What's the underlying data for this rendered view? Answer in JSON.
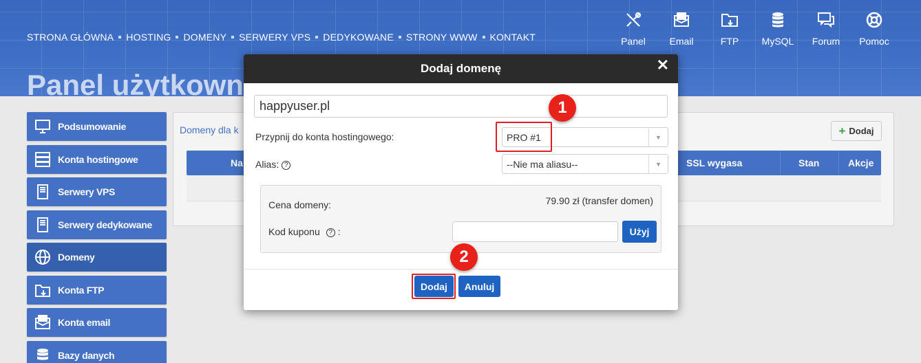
{
  "topnav": {
    "items": [
      "STRONA GŁÓWNA",
      "HOSTING",
      "DOMENY",
      "SERWERY VPS",
      "DEDYKOWANE",
      "STRONY WWW",
      "KONTAKT"
    ]
  },
  "tools": [
    {
      "label": "Panel",
      "icon": "tools-icon"
    },
    {
      "label": "Email",
      "icon": "email-icon"
    },
    {
      "label": "FTP",
      "icon": "ftp-folder-icon"
    },
    {
      "label": "MySQL",
      "icon": "database-icon"
    },
    {
      "label": "Forum",
      "icon": "forum-icon"
    },
    {
      "label": "Pomoc",
      "icon": "lifebuoy-icon"
    }
  ],
  "page_title": "Panel użytkown",
  "sidebar": {
    "items": [
      {
        "label": "Podsumowanie",
        "icon": "monitor-icon"
      },
      {
        "label": "Konta hostingowe",
        "icon": "server-rack-icon"
      },
      {
        "label": "Serwery VPS",
        "icon": "server-tower-icon"
      },
      {
        "label": "Serwery dedykowane",
        "icon": "server-tower-icon"
      },
      {
        "label": "Domeny",
        "icon": "www-globe-icon"
      },
      {
        "label": "Konta FTP",
        "icon": "ftp-folder-icon"
      },
      {
        "label": "Konta email",
        "icon": "email-icon"
      },
      {
        "label": "Bazy danych",
        "icon": "database-icon"
      }
    ]
  },
  "panel": {
    "title": "Domeny dla k",
    "add_button": "Dodaj",
    "columns": {
      "name": "Na",
      "ssl": "SSL wygasa",
      "status": "Stan",
      "actions": "Akcje"
    }
  },
  "modal": {
    "title": "Dodaj domenę",
    "domain_value": "happyuser.pl",
    "hosting_label": "Przypnij do konta hostingowego:",
    "hosting_selected": "PRO #1",
    "alias_label": "Alias:",
    "alias_selected": "--Nie ma aliasu--",
    "price_label": "Cena domeny:",
    "price_value": "79.90 zł (transfer domen)",
    "coupon_label": "Kod kuponu",
    "coupon_suffix": ":",
    "use_button": "Użyj",
    "add_button": "Dodaj",
    "cancel_button": "Anuluj"
  },
  "annotations": {
    "step1": "1",
    "step2": "2",
    "highlight_color": "#e02020"
  },
  "colors": {
    "brand": "#4471c4",
    "button": "#1e62c2",
    "modal_header": "#2b2b2b"
  }
}
